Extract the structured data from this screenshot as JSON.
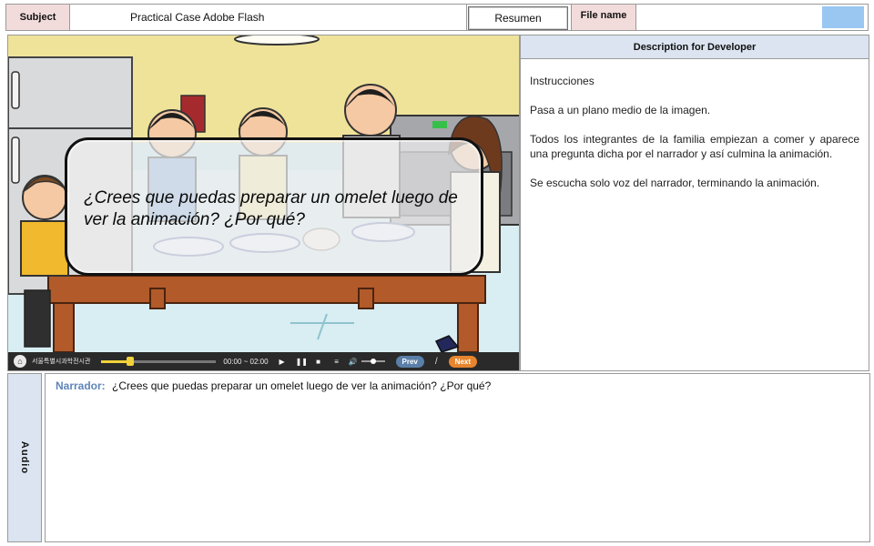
{
  "header": {
    "subject_label": "Subject",
    "subject_value": "Practical Case Adobe Flash",
    "resumen_label": "Resumen",
    "file_name_label": "File name",
    "file_name_value": ""
  },
  "stage": {
    "question": "¿Crees que puedas preparar un omelet luego de ver la animación? ¿Por qué?",
    "player": {
      "org_text": "서울특별시과학전시관",
      "time": "00:00 ~ 02:00",
      "play_icon": "▶",
      "pause_icon": "❚❚",
      "stop_icon": "■",
      "menu_icon": "≡",
      "volume_icon": "🔊",
      "prev_label": "Prev",
      "separator": "/",
      "next_label": "Next",
      "progress_fraction": 0.25,
      "volume_fraction": 0.5
    }
  },
  "description": {
    "title": "Description for Developer",
    "paragraphs": [
      "Instrucciones",
      "Pasa a un plano medio de la imagen.",
      "Todos los integrantes de la familia empiezan a comer y aparece una pregunta dicha por el narrador  y así culmina la animación.",
      "Se escucha solo voz del narrador,  terminando  la animación."
    ]
  },
  "audio": {
    "label": "Audio",
    "speaker": "Narrador:",
    "line": "¿Crees  que puedas preparar un omelet luego de ver la animación? ¿Por qué?"
  },
  "colors": {
    "label_pink": "#f2dcdb",
    "label_blue": "#dbe4f0",
    "narrator_blue": "#5e85b9",
    "file_swatch": "#99c7f2",
    "prev_button": "#5a7fa8",
    "next_button": "#e7852e"
  }
}
